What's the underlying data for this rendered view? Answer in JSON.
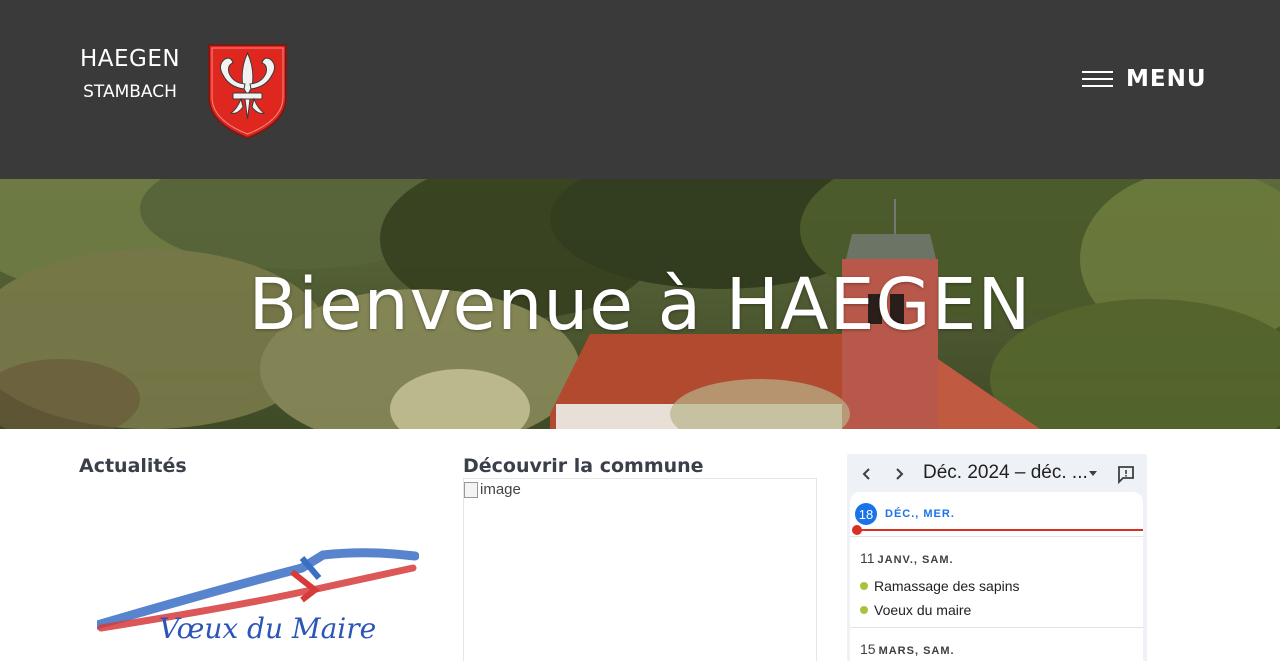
{
  "header": {
    "site_name": "HAEGEN",
    "site_subtitle": "STAMBACH",
    "menu_label": "MENU"
  },
  "hero": {
    "title": "Bienvenue à HAEGEN"
  },
  "news": {
    "title": "Actualités",
    "image_text": "Vœux du Maire"
  },
  "discover": {
    "title": "Découvrir la commune",
    "image_alt": "image"
  },
  "calendar": {
    "range_label": "Déc. 2024 – déc. ...",
    "today": {
      "day": "18",
      "label": "DÉC., MER."
    },
    "days": [
      {
        "day": "11",
        "label": "JANV., SAM.",
        "events": [
          "Ramassage des sapins",
          "Voeux du maire"
        ]
      },
      {
        "day": "15",
        "label": "MARS, SAM.",
        "events": []
      }
    ],
    "event_color": "#a6c43a",
    "today_color": "#1a73e8",
    "now_line_color": "#d93025"
  },
  "colors": {
    "header_bg": "#3a3a3a",
    "crest_red": "#e0271f"
  }
}
